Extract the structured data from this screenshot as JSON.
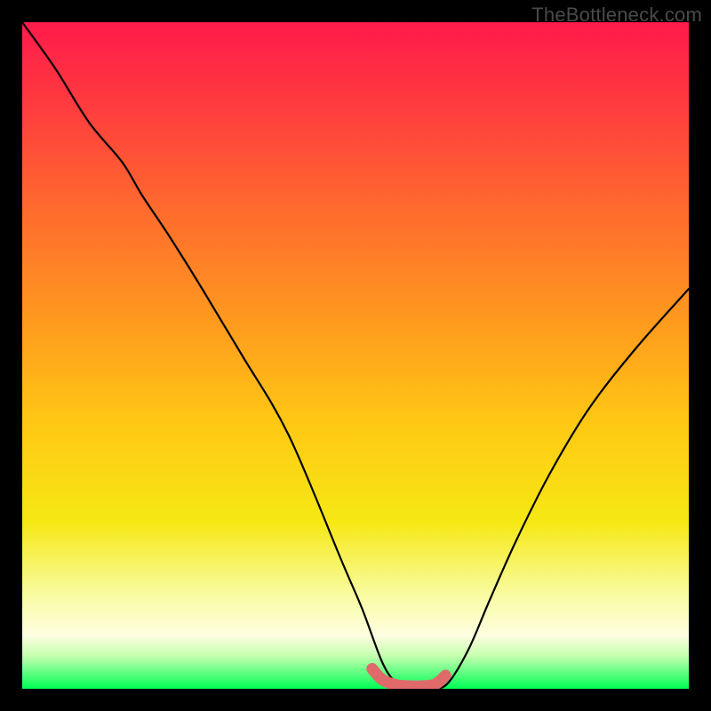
{
  "watermark": "TheBottleneck.com",
  "colors": {
    "background": "#000000",
    "curve": "#000000",
    "overlay_stroke": "#e06a6a",
    "green_band": "#00ff55",
    "gradient_stops": [
      {
        "offset": 0.0,
        "color": "#ff1a4b"
      },
      {
        "offset": 0.12,
        "color": "#ff3a3f"
      },
      {
        "offset": 0.28,
        "color": "#ff6a2e"
      },
      {
        "offset": 0.45,
        "color": "#ff9a1e"
      },
      {
        "offset": 0.6,
        "color": "#ffc814"
      },
      {
        "offset": 0.75,
        "color": "#f6e814"
      },
      {
        "offset": 0.86,
        "color": "#f9fca2"
      },
      {
        "offset": 0.92,
        "color": "#fdfee0"
      },
      {
        "offset": 0.95,
        "color": "#c8ffb0"
      },
      {
        "offset": 1.0,
        "color": "#00ff55"
      }
    ]
  },
  "chart_data": {
    "type": "line",
    "title": "",
    "xlabel": "",
    "ylabel": "",
    "xlim": [
      0,
      100
    ],
    "ylim": [
      0,
      100
    ],
    "series": [
      {
        "name": "bottleneck-curve",
        "x": [
          0,
          5,
          10,
          15,
          18,
          22,
          27,
          33,
          40,
          48,
          51,
          54,
          56,
          58,
          60,
          62,
          64,
          67,
          70,
          74,
          79,
          85,
          92,
          100
        ],
        "y": [
          100,
          93,
          85,
          79,
          74,
          68,
          60,
          50,
          38,
          19,
          12,
          4,
          1,
          0,
          0,
          0,
          1,
          6,
          13,
          22,
          32,
          42,
          51,
          60
        ]
      }
    ],
    "overlay_segment": {
      "name": "highlight-band",
      "x": [
        52.5,
        54,
        56,
        58,
        60,
        62,
        63.5
      ],
      "y": [
        3.0,
        1.4,
        0.6,
        0.4,
        0.4,
        0.7,
        2.0
      ]
    }
  }
}
